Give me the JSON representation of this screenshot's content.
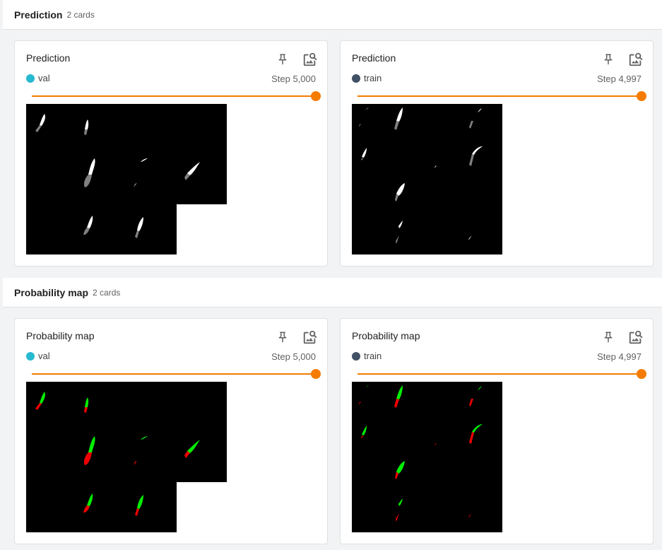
{
  "colors": {
    "accent": "#f57c00",
    "val_run": "#26b9d0",
    "train_run": "#425066",
    "pred_fore": "#ffffff",
    "pred_back": "#808080",
    "prob_fore": "#00ee00",
    "prob_back": "#ee0000"
  },
  "groups": [
    {
      "title": "Prediction",
      "count": "2 cards",
      "cards": [
        {
          "title": "Prediction",
          "run": "val",
          "step": "Step 5,000"
        },
        {
          "title": "Prediction",
          "run": "train",
          "step": "Step 4,997"
        }
      ]
    },
    {
      "title": "Probability map",
      "count": "2 cards",
      "cards": [
        {
          "title": "Probability map",
          "run": "val",
          "step": "Step 5,000"
        },
        {
          "title": "Probability map",
          "run": "train",
          "step": "Step 4,997"
        }
      ]
    }
  ],
  "icons": {
    "pin": "pin-icon",
    "zoom": "image-search-icon"
  },
  "slider": {
    "value_fraction": 1.0
  }
}
